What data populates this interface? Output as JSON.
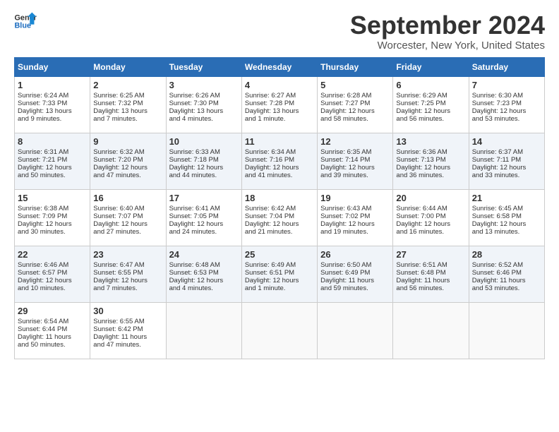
{
  "header": {
    "logo_line1": "General",
    "logo_line2": "Blue",
    "title": "September 2024",
    "subtitle": "Worcester, New York, United States"
  },
  "days_of_week": [
    "Sunday",
    "Monday",
    "Tuesday",
    "Wednesday",
    "Thursday",
    "Friday",
    "Saturday"
  ],
  "weeks": [
    [
      {
        "day": 1,
        "lines": [
          "Sunrise: 6:24 AM",
          "Sunset: 7:33 PM",
          "Daylight: 13 hours",
          "and 9 minutes."
        ]
      },
      {
        "day": 2,
        "lines": [
          "Sunrise: 6:25 AM",
          "Sunset: 7:32 PM",
          "Daylight: 13 hours",
          "and 7 minutes."
        ]
      },
      {
        "day": 3,
        "lines": [
          "Sunrise: 6:26 AM",
          "Sunset: 7:30 PM",
          "Daylight: 13 hours",
          "and 4 minutes."
        ]
      },
      {
        "day": 4,
        "lines": [
          "Sunrise: 6:27 AM",
          "Sunset: 7:28 PM",
          "Daylight: 13 hours",
          "and 1 minute."
        ]
      },
      {
        "day": 5,
        "lines": [
          "Sunrise: 6:28 AM",
          "Sunset: 7:27 PM",
          "Daylight: 12 hours",
          "and 58 minutes."
        ]
      },
      {
        "day": 6,
        "lines": [
          "Sunrise: 6:29 AM",
          "Sunset: 7:25 PM",
          "Daylight: 12 hours",
          "and 56 minutes."
        ]
      },
      {
        "day": 7,
        "lines": [
          "Sunrise: 6:30 AM",
          "Sunset: 7:23 PM",
          "Daylight: 12 hours",
          "and 53 minutes."
        ]
      }
    ],
    [
      {
        "day": 8,
        "lines": [
          "Sunrise: 6:31 AM",
          "Sunset: 7:21 PM",
          "Daylight: 12 hours",
          "and 50 minutes."
        ]
      },
      {
        "day": 9,
        "lines": [
          "Sunrise: 6:32 AM",
          "Sunset: 7:20 PM",
          "Daylight: 12 hours",
          "and 47 minutes."
        ]
      },
      {
        "day": 10,
        "lines": [
          "Sunrise: 6:33 AM",
          "Sunset: 7:18 PM",
          "Daylight: 12 hours",
          "and 44 minutes."
        ]
      },
      {
        "day": 11,
        "lines": [
          "Sunrise: 6:34 AM",
          "Sunset: 7:16 PM",
          "Daylight: 12 hours",
          "and 41 minutes."
        ]
      },
      {
        "day": 12,
        "lines": [
          "Sunrise: 6:35 AM",
          "Sunset: 7:14 PM",
          "Daylight: 12 hours",
          "and 39 minutes."
        ]
      },
      {
        "day": 13,
        "lines": [
          "Sunrise: 6:36 AM",
          "Sunset: 7:13 PM",
          "Daylight: 12 hours",
          "and 36 minutes."
        ]
      },
      {
        "day": 14,
        "lines": [
          "Sunrise: 6:37 AM",
          "Sunset: 7:11 PM",
          "Daylight: 12 hours",
          "and 33 minutes."
        ]
      }
    ],
    [
      {
        "day": 15,
        "lines": [
          "Sunrise: 6:38 AM",
          "Sunset: 7:09 PM",
          "Daylight: 12 hours",
          "and 30 minutes."
        ]
      },
      {
        "day": 16,
        "lines": [
          "Sunrise: 6:40 AM",
          "Sunset: 7:07 PM",
          "Daylight: 12 hours",
          "and 27 minutes."
        ]
      },
      {
        "day": 17,
        "lines": [
          "Sunrise: 6:41 AM",
          "Sunset: 7:05 PM",
          "Daylight: 12 hours",
          "and 24 minutes."
        ]
      },
      {
        "day": 18,
        "lines": [
          "Sunrise: 6:42 AM",
          "Sunset: 7:04 PM",
          "Daylight: 12 hours",
          "and 21 minutes."
        ]
      },
      {
        "day": 19,
        "lines": [
          "Sunrise: 6:43 AM",
          "Sunset: 7:02 PM",
          "Daylight: 12 hours",
          "and 19 minutes."
        ]
      },
      {
        "day": 20,
        "lines": [
          "Sunrise: 6:44 AM",
          "Sunset: 7:00 PM",
          "Daylight: 12 hours",
          "and 16 minutes."
        ]
      },
      {
        "day": 21,
        "lines": [
          "Sunrise: 6:45 AM",
          "Sunset: 6:58 PM",
          "Daylight: 12 hours",
          "and 13 minutes."
        ]
      }
    ],
    [
      {
        "day": 22,
        "lines": [
          "Sunrise: 6:46 AM",
          "Sunset: 6:57 PM",
          "Daylight: 12 hours",
          "and 10 minutes."
        ]
      },
      {
        "day": 23,
        "lines": [
          "Sunrise: 6:47 AM",
          "Sunset: 6:55 PM",
          "Daylight: 12 hours",
          "and 7 minutes."
        ]
      },
      {
        "day": 24,
        "lines": [
          "Sunrise: 6:48 AM",
          "Sunset: 6:53 PM",
          "Daylight: 12 hours",
          "and 4 minutes."
        ]
      },
      {
        "day": 25,
        "lines": [
          "Sunrise: 6:49 AM",
          "Sunset: 6:51 PM",
          "Daylight: 12 hours",
          "and 1 minute."
        ]
      },
      {
        "day": 26,
        "lines": [
          "Sunrise: 6:50 AM",
          "Sunset: 6:49 PM",
          "Daylight: 11 hours",
          "and 59 minutes."
        ]
      },
      {
        "day": 27,
        "lines": [
          "Sunrise: 6:51 AM",
          "Sunset: 6:48 PM",
          "Daylight: 11 hours",
          "and 56 minutes."
        ]
      },
      {
        "day": 28,
        "lines": [
          "Sunrise: 6:52 AM",
          "Sunset: 6:46 PM",
          "Daylight: 11 hours",
          "and 53 minutes."
        ]
      }
    ],
    [
      {
        "day": 29,
        "lines": [
          "Sunrise: 6:54 AM",
          "Sunset: 6:44 PM",
          "Daylight: 11 hours",
          "and 50 minutes."
        ]
      },
      {
        "day": 30,
        "lines": [
          "Sunrise: 6:55 AM",
          "Sunset: 6:42 PM",
          "Daylight: 11 hours",
          "and 47 minutes."
        ]
      },
      null,
      null,
      null,
      null,
      null
    ]
  ]
}
